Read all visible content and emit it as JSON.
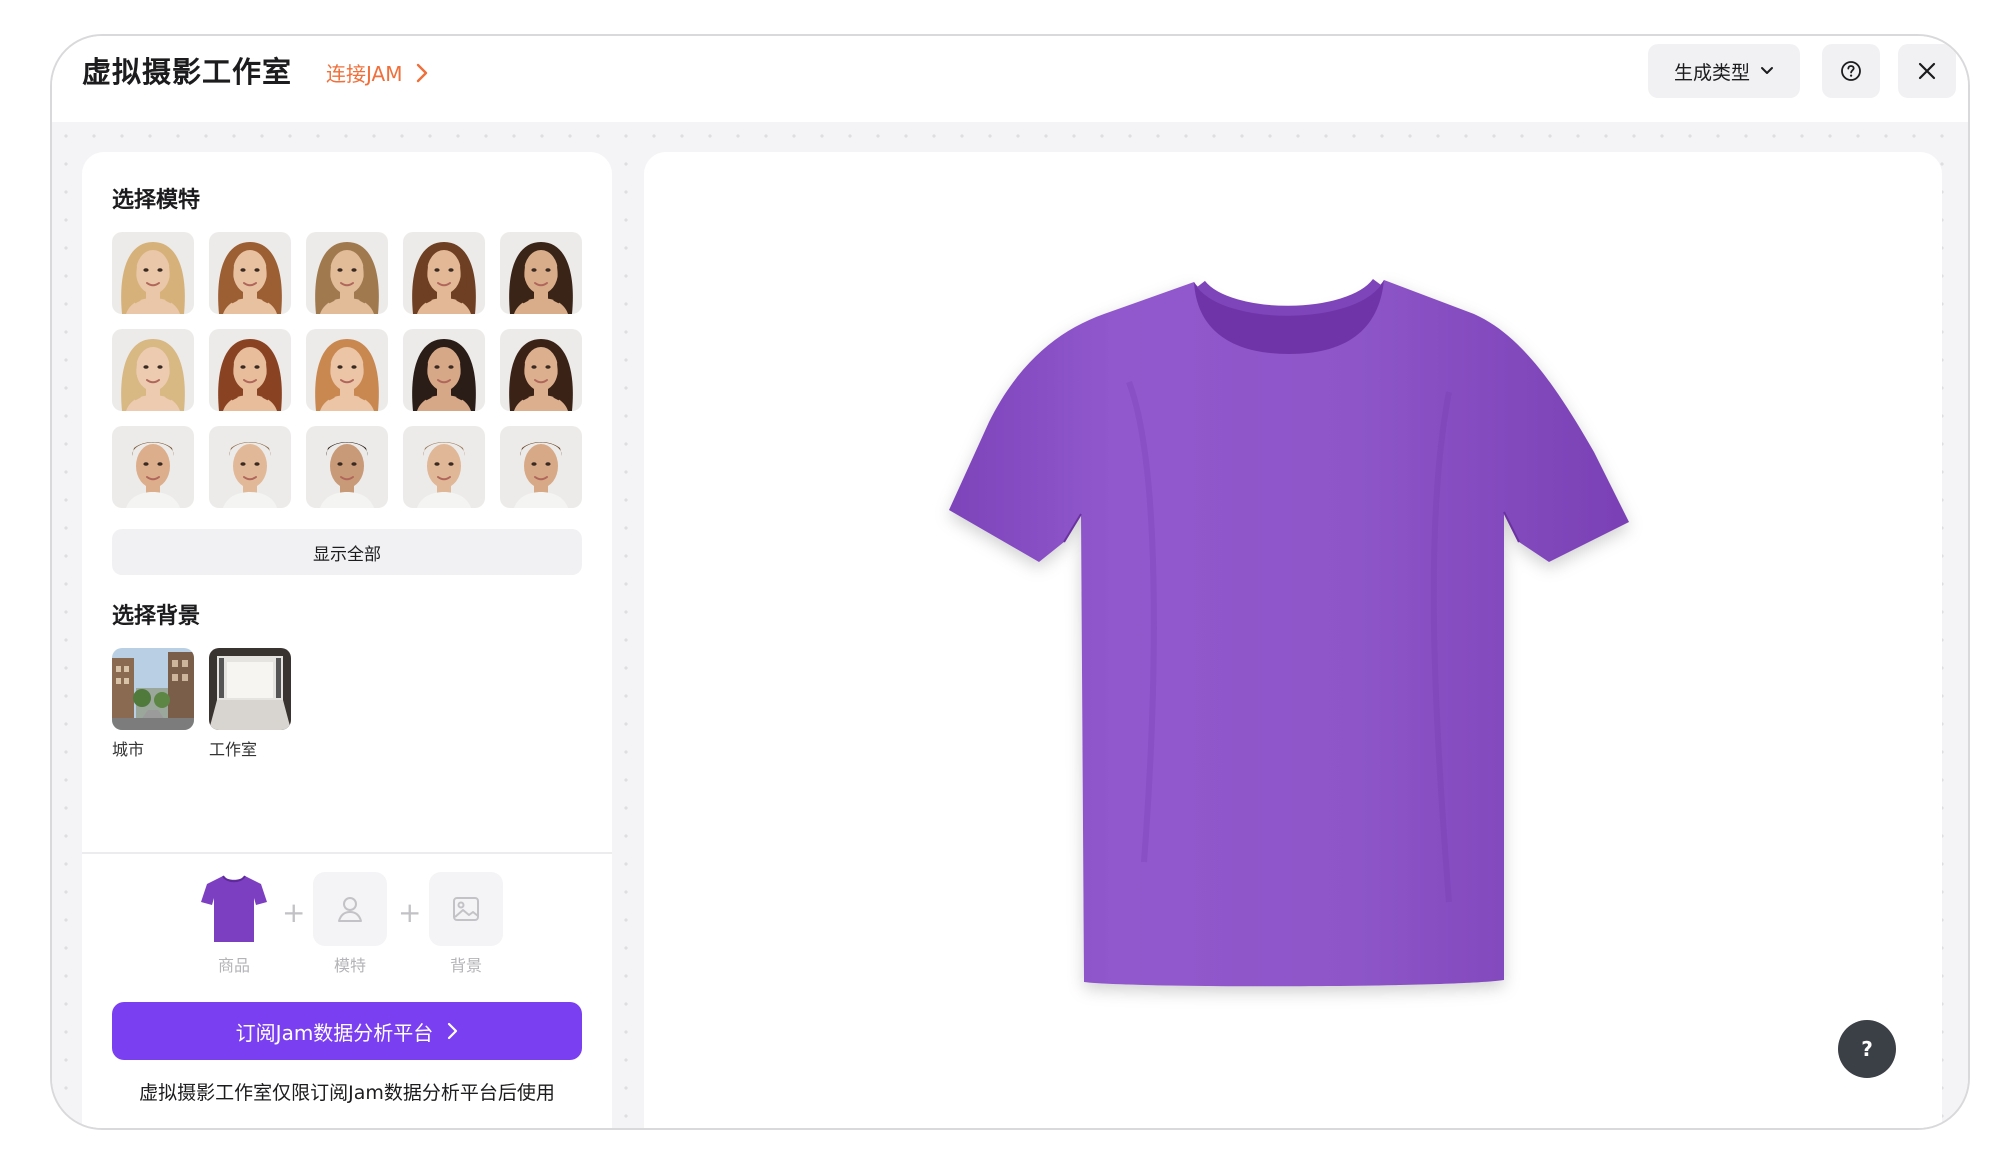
{
  "header": {
    "title": "虚拟摄影工作室",
    "connect_label": "连接JAM",
    "generate_type_label": "生成类型"
  },
  "sidebar": {
    "models_title": "选择模特",
    "models": [
      {
        "name": "model-1",
        "hair": "#d6b27a",
        "skin": "#e9c7a8"
      },
      {
        "name": "model-2",
        "hair": "#9c5e33",
        "skin": "#e8c1a0"
      },
      {
        "name": "model-3",
        "hair": "#a07a4e",
        "skin": "#e2bc99"
      },
      {
        "name": "model-4",
        "hair": "#6e3f22",
        "skin": "#e3b896"
      },
      {
        "name": "model-5",
        "hair": "#3a2418",
        "skin": "#d9ad8a"
      },
      {
        "name": "model-6",
        "hair": "#d8b883",
        "skin": "#edcbb0"
      },
      {
        "name": "model-7",
        "hair": "#8a4322",
        "skin": "#e7bd9c"
      },
      {
        "name": "model-8",
        "hair": "#c98850",
        "skin": "#ebc5a6"
      },
      {
        "name": "model-9",
        "hair": "#2a1c16",
        "skin": "#d6a888"
      },
      {
        "name": "model-10",
        "hair": "#3b2217",
        "skin": "#dcb08f"
      },
      {
        "name": "model-11",
        "hair": "#7a5634",
        "skin": "#dcae8c"
      },
      {
        "name": "model-12",
        "hair": "#8f6e4c",
        "skin": "#e2b998"
      },
      {
        "name": "model-13",
        "hair": "#2e2019",
        "skin": "#c99a78"
      },
      {
        "name": "model-14",
        "hair": "#9a7a5a",
        "skin": "#e0b797"
      },
      {
        "name": "model-15",
        "hair": "#6a4528",
        "skin": "#d8a986"
      }
    ],
    "show_all_label": "显示全部",
    "backgrounds_title": "选择背景",
    "backgrounds": [
      {
        "label": "城市"
      },
      {
        "label": "工作室"
      }
    ],
    "composer": {
      "product_label": "商品",
      "model_label": "模特",
      "background_label": "背景"
    },
    "subscribe_label": "订阅Jam数据分析平台",
    "notice": "虚拟摄影工作室仅限订阅Jam数据分析平台后使用"
  },
  "preview": {
    "shirt_color": "#8f56c9"
  },
  "floating_help_label": "?",
  "colors": {
    "accent": "#7b3ff2",
    "link": "#f06f3a"
  }
}
